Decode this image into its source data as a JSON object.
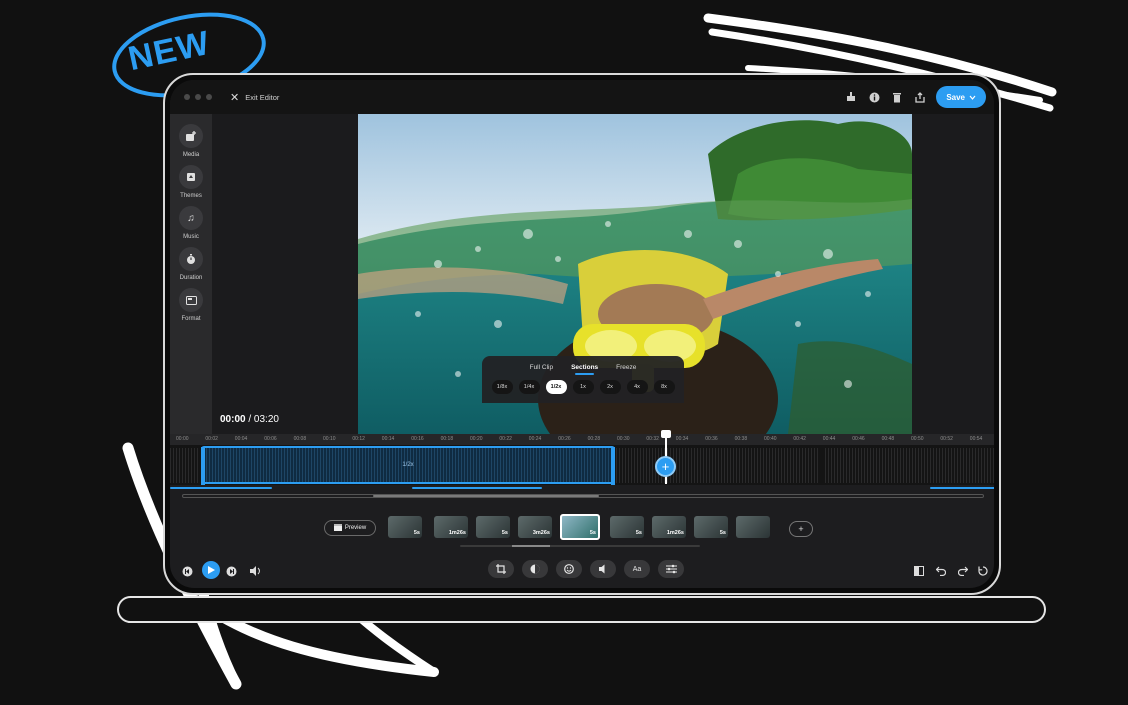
{
  "badge": {
    "text": "NEW"
  },
  "topbar": {
    "exit_label": "Exit Editor",
    "save_label": "Save",
    "icons": [
      "tray-icon",
      "info-icon",
      "trash-icon",
      "share-icon"
    ]
  },
  "sidebar": {
    "items": [
      {
        "label": "Media",
        "icon": "media-add-icon"
      },
      {
        "label": "Themes",
        "icon": "themes-icon"
      },
      {
        "label": "Music",
        "icon": "music-icon"
      },
      {
        "label": "Duration",
        "icon": "timer-icon"
      },
      {
        "label": "Format",
        "icon": "format-icon"
      }
    ]
  },
  "viewer": {
    "current_time": "00:00",
    "separator": "/",
    "total_time": "03:20"
  },
  "speed_panel": {
    "tabs": [
      "Full Clip",
      "Sections",
      "Freeze"
    ],
    "active_tab": "Sections",
    "speeds": [
      "1/8x",
      "1/4x",
      "1/2x",
      "1x",
      "2x",
      "4x",
      "8x"
    ],
    "selected_speed": "1/2x"
  },
  "timeline": {
    "ticks": [
      "00:00",
      "00:02",
      "00:04",
      "00:06",
      "00:08",
      "00:10",
      "00:12",
      "00:14",
      "00:16",
      "00:18",
      "00:20",
      "00:22",
      "00:24",
      "00:26",
      "00:28",
      "00:30",
      "00:32",
      "00:34",
      "00:36",
      "00:38",
      "00:40",
      "00:42",
      "00:44",
      "00:46",
      "00:48",
      "00:50",
      "00:52",
      "00:54"
    ],
    "selection_label": "1/2x",
    "add_symbol": "+"
  },
  "clips_strip": {
    "preview_label": "Preview",
    "thumbs": [
      {
        "duration": "5s"
      },
      {
        "duration": "1m26s"
      },
      {
        "duration": "5s"
      },
      {
        "duration": "3m26s"
      },
      {
        "duration": "5s",
        "active": true
      },
      {
        "duration": "5s"
      },
      {
        "duration": "1m26s"
      },
      {
        "duration": "5s"
      },
      {
        "duration": ""
      }
    ],
    "add_label": "+"
  },
  "controls": {
    "tools": [
      {
        "name": "crop-tool-button",
        "icon": "crop-icon"
      },
      {
        "name": "filter-tool-button",
        "icon": "filter-icon"
      },
      {
        "name": "sticker-tool-button",
        "icon": "sticker-icon"
      },
      {
        "name": "volume-tool-button",
        "icon": "speaker-icon"
      },
      {
        "name": "text-tool-button",
        "icon": "text-icon",
        "label": "Aa"
      },
      {
        "name": "adjust-tool-button",
        "icon": "sliders-icon"
      }
    ]
  },
  "colors": {
    "accent": "#2c9df2",
    "background": "#111111",
    "panel": "#1d1d1f"
  }
}
